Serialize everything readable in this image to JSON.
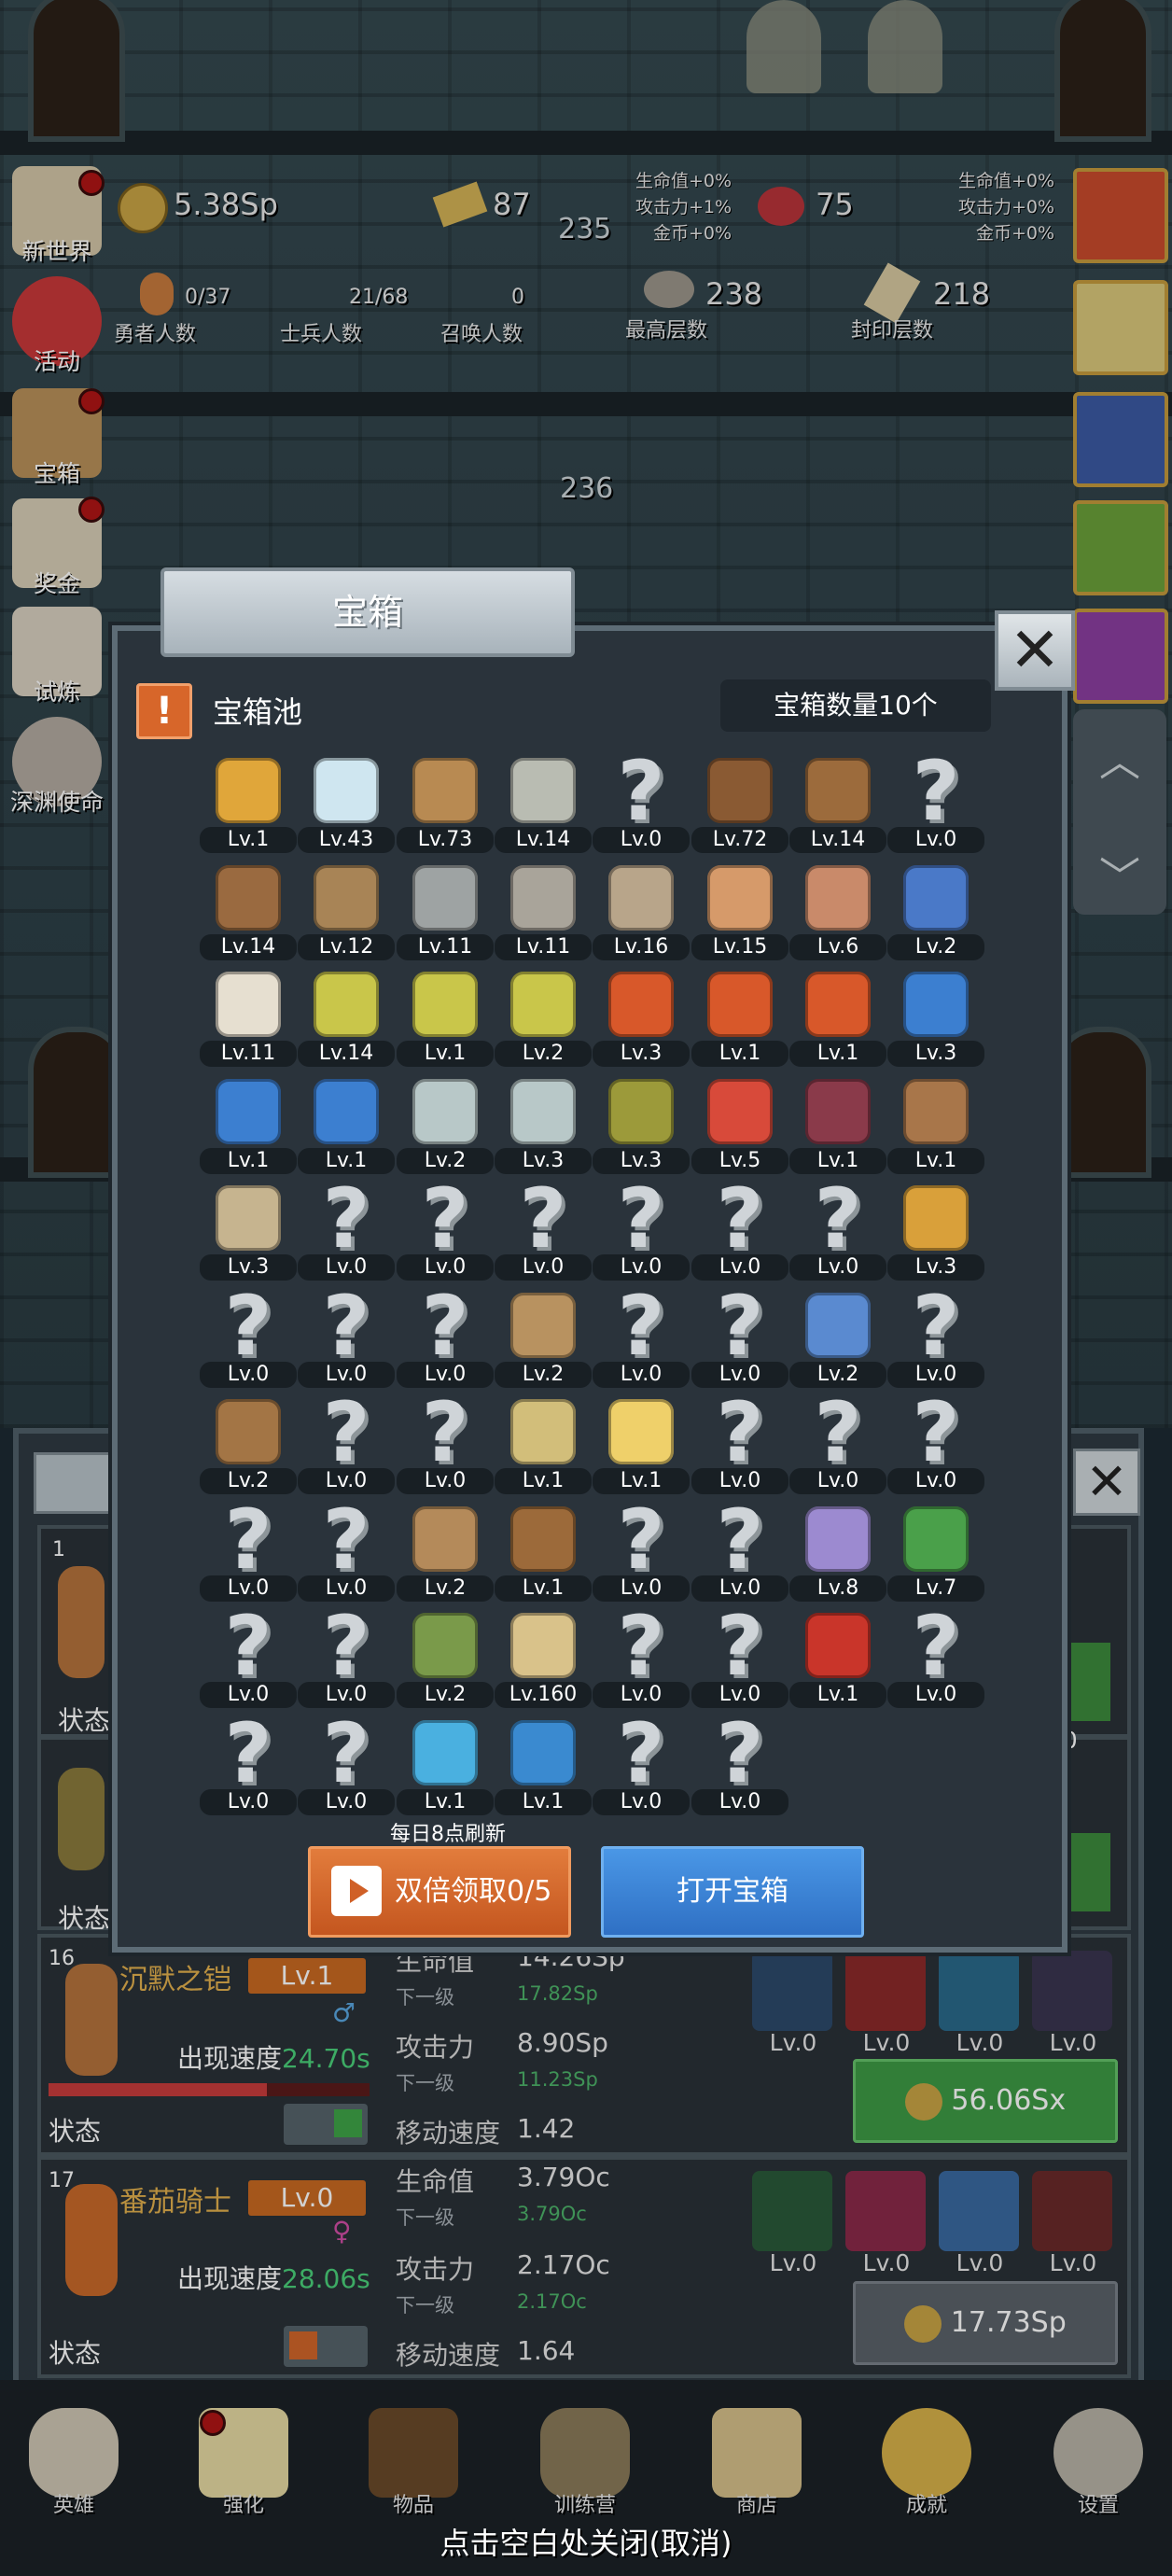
{
  "top_stats": {
    "coins": "5.38Sp",
    "gold_bars": "87",
    "meat": "75",
    "floor_marker_a": "235",
    "floor_marker_b": "236",
    "bonus_left": [
      "生命值+0%",
      "攻击力+1%",
      "金币+0%"
    ],
    "bonus_right": [
      "生命值+0%",
      "攻击力+0%",
      "金币+0%"
    ],
    "hero_count": "0/37",
    "hero_label": "勇者人数",
    "soldier_count": "21/68",
    "soldier_label": "士兵人数",
    "summon_count": "0",
    "summon_label": "召唤人数",
    "highest_floor": "238",
    "highest_label": "最高层数",
    "seal_floor": "218",
    "seal_label": "封印层数"
  },
  "left_menu": [
    "新世界",
    "活动",
    "宝箱",
    "奖金",
    "试炼",
    "深渊使命"
  ],
  "modal": {
    "title": "宝箱",
    "pool_title": "宝箱池",
    "pool_icon": "!",
    "chest_count": "宝箱数量10个",
    "refresh_note": "每日8点刷新",
    "double_button": "双倍领取0/5",
    "open_button": "打开宝箱",
    "items": [
      [
        "crown",
        "Lv.1"
      ],
      [
        "diamond",
        "Lv.43"
      ],
      [
        "wood-sword",
        "Lv.73"
      ],
      [
        "iron-sword",
        "Lv.14"
      ],
      [
        "unknown",
        "Lv.0"
      ],
      [
        "leather-armor",
        "Lv.72"
      ],
      [
        "backpack",
        "Lv.14"
      ],
      [
        "unknown",
        "Lv.0"
      ],
      [
        "leather-helmet",
        "Lv.14"
      ],
      [
        "dagger",
        "Lv.12"
      ],
      [
        "knight-helmet",
        "Lv.11"
      ],
      [
        "hammer",
        "Lv.11"
      ],
      [
        "great-helm",
        "Lv.16"
      ],
      [
        "ham",
        "Lv.15"
      ],
      [
        "steak",
        "Lv.6"
      ],
      [
        "money-bag",
        "Lv.2"
      ],
      [
        "flour",
        "Lv.11"
      ],
      [
        "yellow-potion",
        "Lv.14"
      ],
      [
        "yellow-potion",
        "Lv.1"
      ],
      [
        "yellow-potion",
        "Lv.2"
      ],
      [
        "red-potion",
        "Lv.3"
      ],
      [
        "red-potion",
        "Lv.1"
      ],
      [
        "red-potion",
        "Lv.1"
      ],
      [
        "blue-potion",
        "Lv.3"
      ],
      [
        "blue-potion",
        "Lv.1"
      ],
      [
        "blue-potion",
        "Lv.1"
      ],
      [
        "empty-bottle",
        "Lv.2"
      ],
      [
        "empty-bottle",
        "Lv.3"
      ],
      [
        "olive-bottle",
        "Lv.3"
      ],
      [
        "red-vial",
        "Lv.5"
      ],
      [
        "winged-boot",
        "Lv.1"
      ],
      [
        "boot",
        "Lv.1"
      ],
      [
        "cloth-shoe",
        "Lv.3"
      ],
      [
        "unknown",
        "Lv.0"
      ],
      [
        "unknown",
        "Lv.0"
      ],
      [
        "unknown",
        "Lv.0"
      ],
      [
        "unknown",
        "Lv.0"
      ],
      [
        "unknown",
        "Lv.0"
      ],
      [
        "unknown",
        "Lv.0"
      ],
      [
        "torch",
        "Lv.3"
      ],
      [
        "unknown",
        "Lv.0"
      ],
      [
        "unknown",
        "Lv.0"
      ],
      [
        "unknown",
        "Lv.0"
      ],
      [
        "wooden-staff",
        "Lv.2"
      ],
      [
        "unknown",
        "Lv.0"
      ],
      [
        "unknown",
        "Lv.0"
      ],
      [
        "magic-staff",
        "Lv.2"
      ],
      [
        "unknown",
        "Lv.0"
      ],
      [
        "leather-bag",
        "Lv.2"
      ],
      [
        "unknown",
        "Lv.0"
      ],
      [
        "unknown",
        "Lv.0"
      ],
      [
        "straw-broom",
        "Lv.1"
      ],
      [
        "cheese",
        "Lv.1"
      ],
      [
        "unknown",
        "Lv.0"
      ],
      [
        "unknown",
        "Lv.0"
      ],
      [
        "unknown",
        "Lv.0"
      ],
      [
        "unknown",
        "Lv.0"
      ],
      [
        "unknown",
        "Lv.0"
      ],
      [
        "bow",
        "Lv.2"
      ],
      [
        "quiver",
        "Lv.1"
      ],
      [
        "unknown",
        "Lv.0"
      ],
      [
        "unknown",
        "Lv.0"
      ],
      [
        "gem-ring",
        "Lv.8"
      ],
      [
        "emerald-shield",
        "Lv.7"
      ],
      [
        "unknown",
        "Lv.0"
      ],
      [
        "unknown",
        "Lv.0"
      ],
      [
        "green-wand",
        "Lv.2"
      ],
      [
        "beer-mug",
        "Lv.160"
      ],
      [
        "unknown",
        "Lv.0"
      ],
      [
        "unknown",
        "Lv.0"
      ],
      [
        "red-book",
        "Lv.1"
      ],
      [
        "unknown",
        "Lv.0"
      ],
      [
        "unknown",
        "Lv.0"
      ],
      [
        "unknown",
        "Lv.0"
      ],
      [
        "crystal-ball",
        "Lv.1"
      ],
      [
        "blue-rune",
        "Lv.1"
      ],
      [
        "unknown",
        "Lv.0"
      ],
      [
        "unknown",
        "Lv.0"
      ]
    ]
  },
  "heroes": {
    "row1_number": "1",
    "row_status": "状态",
    "row16": {
      "number": "16",
      "name": "沉默之铠",
      "level": "Lv.1",
      "speed_label": "出现速度",
      "speed": "24.70s",
      "hp_label": "生命值",
      "hp": "14.26Sp",
      "next_label": "下一级",
      "hp_next": "17.82Sp",
      "atk_label": "攻击力",
      "atk": "8.90Sp",
      "atk_next": "11.23Sp",
      "move_label": "移动速度",
      "move": "1.42",
      "skill_levels": [
        "Lv.0",
        "Lv.0",
        "Lv.0",
        "Lv.0"
      ],
      "cost": "56.06Sx",
      "status": "状态"
    },
    "row17": {
      "number": "17",
      "name": "番茄骑士",
      "level": "Lv.0",
      "speed_label": "出现速度",
      "speed": "28.06s",
      "hp_label": "生命值",
      "hp": "3.79Oc",
      "next_label": "下一级",
      "hp_next": "3.79Oc",
      "atk_label": "攻击力",
      "atk": "2.17Oc",
      "atk_next": "2.17Oc",
      "move_label": "移动速度",
      "move": "1.64",
      "skill_levels": [
        "Lv.0",
        "Lv.0",
        "Lv.0",
        "Lv.0"
      ],
      "cost": "17.73Sp",
      "status": "状态"
    },
    "partial_lv": "Lv.0"
  },
  "nav": [
    "英雄",
    "强化",
    "物品",
    "训练营",
    "商店",
    "成就",
    "设置"
  ],
  "close_hint": "点击空白处关闭(取消)"
}
